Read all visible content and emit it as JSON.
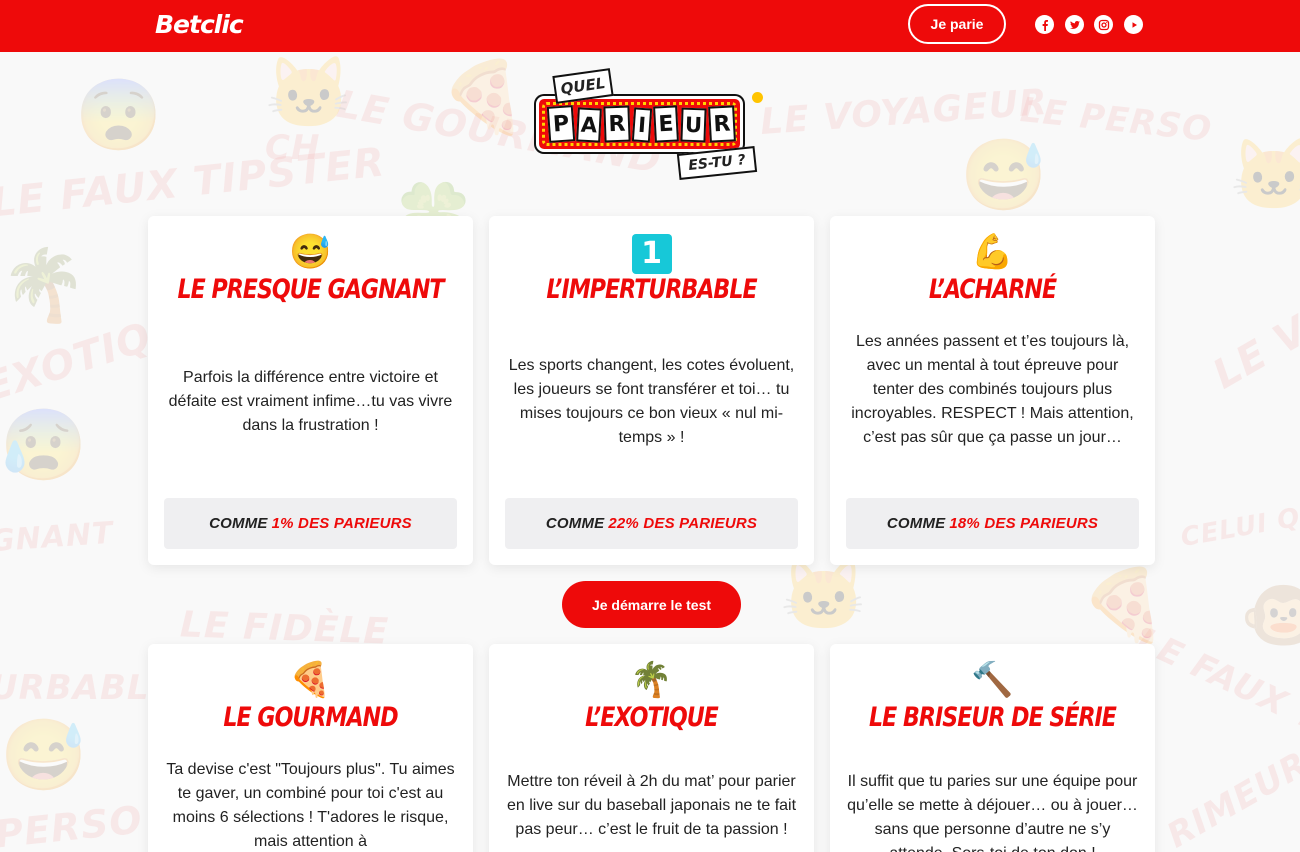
{
  "header": {
    "logo": "Betclic",
    "bet_button": "Je parie",
    "social": [
      "facebook-icon",
      "twitter-icon",
      "instagram-icon",
      "youtube-icon"
    ],
    "accent_color": "#ee0a0a"
  },
  "quiz_logo": {
    "line1": "QUEL",
    "tiles": [
      "P",
      "A",
      "R",
      "I",
      "E",
      "U",
      "R"
    ],
    "line3": "ES-TU ?"
  },
  "background_words": [
    "LE FAUX TIPSTER",
    "LE GOURMAND",
    "LE VOYAGEUR",
    "LE PERSO",
    "EXOTIQUE",
    "LE FIDÈLE",
    "URBABLE",
    "GNANT",
    "LE FAUX T",
    "RIMEUR",
    "CELUI QUI",
    "CH",
    "PERSO",
    "LE V"
  ],
  "cards": [
    {
      "emoji": "😅",
      "title": "LE PRESQUE GAGNANT",
      "description": "Parfois la différence entre victoire et défaite est vraiment infime…tu vas vivre dans la frustration !",
      "stat_prefix": "COMME",
      "stat_value": "1% DES PARIEURS"
    },
    {
      "emoji": "1",
      "title": "L’IMPERTURBABLE",
      "description": "Les sports changent, les cotes évoluent, les joueurs se font transférer et toi… tu mises toujours ce bon vieux « nul mi-temps » !",
      "stat_prefix": "COMME",
      "stat_value": "22% DES PARIEURS"
    },
    {
      "emoji": "💪",
      "title": "L’ACHARNÉ",
      "description": "Les années passent et t’es toujours là, avec un mental à tout épreuve pour tenter des combinés toujours plus incroyables. RESPECT ! Mais attention, c’est pas sûr que ça passe un jour…",
      "stat_prefix": "COMME",
      "stat_value": "18% DES PARIEURS"
    },
    {
      "emoji": "🍕",
      "title": "LE GOURMAND",
      "description": "Ta devise c'est \"Toujours plus\". Tu aimes te gaver, un combiné pour toi c'est au moins 6 sélections ! T'adores le risque, mais attention à"
    },
    {
      "emoji": "🌴",
      "title": "L’EXOTIQUE",
      "description": "Mettre ton réveil à 2h du mat’ pour parier en live sur du baseball japonais ne te fait pas peur… c’est le fruit de ta passion !"
    },
    {
      "emoji": "🔨",
      "title": "LE BRISEUR DE SÉRIE",
      "description": "Il suffit que tu paries sur une équipe pour qu’elle se mette à déjouer… ou à jouer… sans que personne d’autre ne s’y attende. Sors-toi de ton don !"
    }
  ],
  "start_button": "Je démarre le test"
}
